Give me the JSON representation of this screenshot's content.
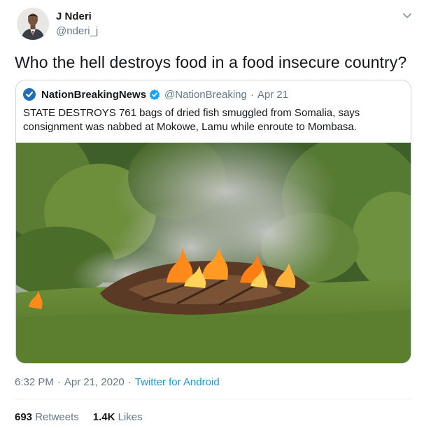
{
  "author": {
    "display_name": "J Nderi",
    "handle": "@nderi_j",
    "avatar_icon": "profile-photo"
  },
  "tweet": {
    "text": "Who the hell destroys food in a food insecure country?"
  },
  "quoted_tweet": {
    "display_name": "NationBreakingNews",
    "handle": "@NationBreaking",
    "separator": "·",
    "date": "Apr 21",
    "verified": true,
    "text": "STATE DESTROYS 761 bags of dried fish smuggled from Somalia, says consignment was nabbed at Mokowe, Lamu while enroute to Mombasa.",
    "media_icon": "burning-pile-photo"
  },
  "meta": {
    "time": "6:32 PM",
    "separator1": "·",
    "date": "Apr 21, 2020",
    "separator2": "·",
    "source": "Twitter for Android"
  },
  "stats": {
    "retweets_count": "693",
    "retweets_label": "Retweets",
    "likes_count": "1.4K",
    "likes_label": "Likes"
  },
  "colors": {
    "text": "#14171a",
    "secondary": "#657786",
    "link": "#1b95e0",
    "border": "#ccd6dd",
    "verified": "#1da1f2"
  }
}
